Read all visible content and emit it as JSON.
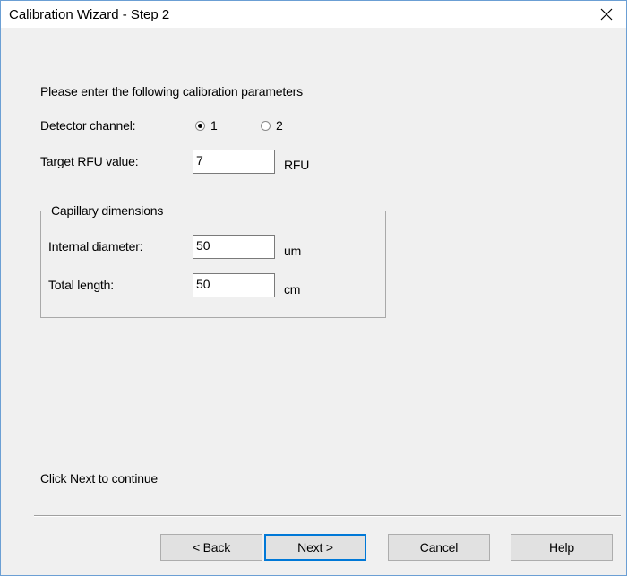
{
  "window": {
    "title": "Calibration Wizard - Step 2"
  },
  "intro": "Please enter the following calibration parameters",
  "detector": {
    "label": "Detector channel:",
    "options": [
      {
        "label": "1",
        "selected": true
      },
      {
        "label": "2",
        "selected": false
      }
    ]
  },
  "target": {
    "label": "Target RFU value:",
    "value": "7",
    "unit": "RFU"
  },
  "capillary": {
    "group_label": "Capillary dimensions",
    "internal_diameter": {
      "label": "Internal diameter:",
      "value": "50",
      "unit": "um"
    },
    "total_length": {
      "label": "Total length:",
      "value": "50",
      "unit": "cm"
    }
  },
  "footer_hint": "Click Next to continue",
  "buttons": {
    "back": "< Back",
    "next": "Next >",
    "cancel": "Cancel",
    "help": "Help"
  },
  "colors": {
    "accent": "#0078d7",
    "window_border": "#6b9fd4",
    "dialog_bg": "#f0f0f0"
  }
}
